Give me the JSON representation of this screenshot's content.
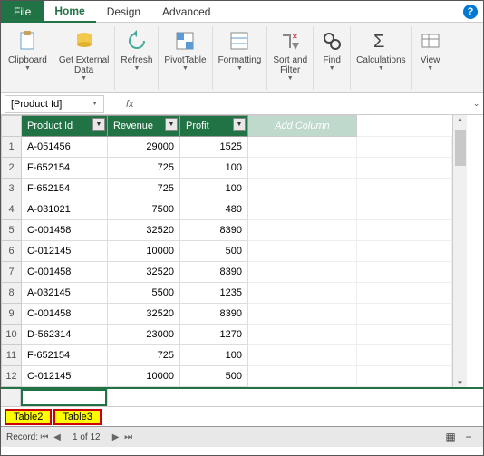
{
  "menubar": {
    "file": "File",
    "tabs": [
      "Home",
      "Design",
      "Advanced"
    ],
    "active_tab": 0
  },
  "ribbon": {
    "groups": [
      {
        "label": "Clipboard"
      },
      {
        "label": "Get External\nData"
      },
      {
        "label": "Refresh"
      },
      {
        "label": "PivotTable"
      },
      {
        "label": "Formatting"
      },
      {
        "label": "Sort and\nFilter"
      },
      {
        "label": "Find"
      },
      {
        "label": "Calculations"
      },
      {
        "label": "View"
      }
    ]
  },
  "formula_bar": {
    "namebox": "[Product Id]",
    "fx": "fx"
  },
  "grid": {
    "headers": [
      "Product Id",
      "Revenue",
      "Profit"
    ],
    "add_column": "Add Column",
    "rows": [
      {
        "n": 1,
        "id": "A-051456",
        "rev": "29000",
        "profit": "1525"
      },
      {
        "n": 2,
        "id": "F-652154",
        "rev": "725",
        "profit": "100"
      },
      {
        "n": 3,
        "id": "F-652154",
        "rev": "725",
        "profit": "100"
      },
      {
        "n": 4,
        "id": "A-031021",
        "rev": "7500",
        "profit": "480"
      },
      {
        "n": 5,
        "id": "C-001458",
        "rev": "32520",
        "profit": "8390"
      },
      {
        "n": 6,
        "id": "C-012145",
        "rev": "10000",
        "profit": "500"
      },
      {
        "n": 7,
        "id": "C-001458",
        "rev": "32520",
        "profit": "8390"
      },
      {
        "n": 8,
        "id": "A-032145",
        "rev": "5500",
        "profit": "1235"
      },
      {
        "n": 9,
        "id": "C-001458",
        "rev": "32520",
        "profit": "8390"
      },
      {
        "n": 10,
        "id": "D-562314",
        "rev": "23000",
        "profit": "1270"
      },
      {
        "n": 11,
        "id": "F-652154",
        "rev": "725",
        "profit": "100"
      },
      {
        "n": 12,
        "id": "C-012145",
        "rev": "10000",
        "profit": "500"
      }
    ]
  },
  "sheets": [
    "Table2",
    "Table3"
  ],
  "statusbar": {
    "label": "Record:",
    "position": "1 of 12"
  }
}
